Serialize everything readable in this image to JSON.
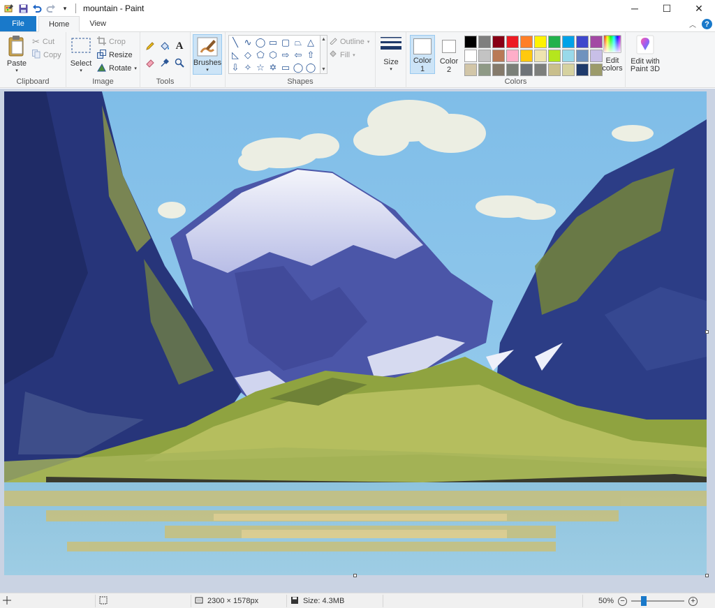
{
  "window": {
    "title": "mountain - Paint",
    "minimize": "─",
    "maximize": "☐",
    "close": "✕"
  },
  "tabs": {
    "file": "File",
    "home": "Home",
    "view": "View"
  },
  "ribbon": {
    "clipboard": {
      "label": "Clipboard",
      "paste": "Paste",
      "cut": "Cut",
      "copy": "Copy"
    },
    "image": {
      "label": "Image",
      "select": "Select",
      "crop": "Crop",
      "resize": "Resize",
      "rotate": "Rotate"
    },
    "tools": {
      "label": "Tools"
    },
    "brushes": {
      "label": "Brushes"
    },
    "shapes": {
      "label": "Shapes",
      "outline": "Outline",
      "fill": "Fill"
    },
    "size": {
      "label": "Size"
    },
    "colors": {
      "label": "Colors",
      "color1": "Color 1",
      "color1_a": "Color",
      "color1_b": "1",
      "color2_a": "Color",
      "color2_b": "2",
      "edit_colors_a": "Edit",
      "edit_colors_b": "colors",
      "edit_3d_a": "Edit with",
      "edit_3d_b": "Paint 3D",
      "palette": [
        "#000000",
        "#7f7f7f",
        "#880015",
        "#ed1c24",
        "#ff7f27",
        "#fff200",
        "#22b14c",
        "#00a2e8",
        "#3f48cc",
        "#a349a4",
        "#ffffff",
        "#c3c3c3",
        "#b97a57",
        "#ffaec9",
        "#ffc90e",
        "#efe4b0",
        "#b5e61d",
        "#99d9ea",
        "#7092be",
        "#c8bfe7",
        "#d2c6a8",
        "#8f9a86",
        "#857a6b",
        "#7a7f78",
        "#6e7378",
        "#7d7f7c",
        "#c9bf8c",
        "#d6d2a0",
        "#1f3a6b",
        "#9c9b6b"
      ]
    }
  },
  "statusbar": {
    "dimensions": "2300 × 1578px",
    "size": "Size: 4.3MB",
    "zoom": "50%"
  }
}
